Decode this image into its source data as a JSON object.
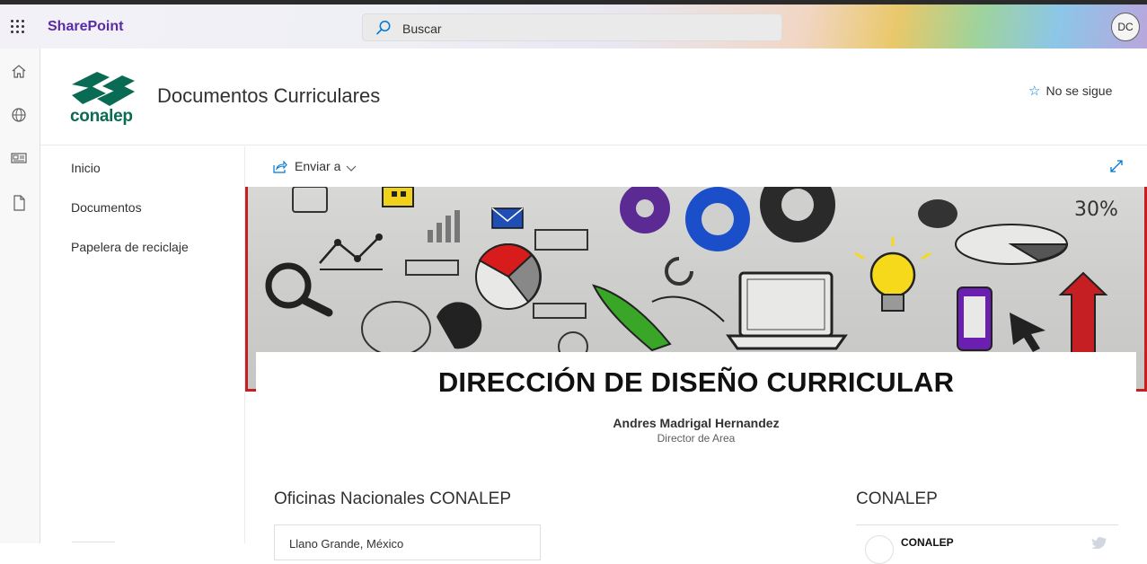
{
  "suite": {
    "brand": "SharePoint",
    "search_placeholder": "Buscar",
    "avatar_initials": "DC"
  },
  "rail": {
    "icons": [
      "home-icon",
      "globe-icon",
      "news-icon",
      "document-icon"
    ]
  },
  "site": {
    "logo_text": "conalep",
    "title": "Documentos Curriculares",
    "follow_label": "No se sigue"
  },
  "nav": {
    "items": [
      {
        "label": "Inicio"
      },
      {
        "label": "Documentos"
      },
      {
        "label": "Papelera de reciclaje"
      }
    ]
  },
  "commandbar": {
    "send_label": "Enviar a"
  },
  "hero": {
    "title": "DIRECCIÓN DE DISEÑO CURRICULAR",
    "person_name": "Andres Madrigal Hernandez",
    "person_role": "Director de Area"
  },
  "sections": {
    "left_title": "Oficinas Nacionales CONALEP",
    "left_location": "Llano Grande, México",
    "right_title": "CONALEP",
    "twitter_name": "CONALEP"
  },
  "colors": {
    "brand_purple": "#5b2ba6",
    "accent_blue": "#0078d4",
    "hero_border_red": "#c51f24",
    "conalep_green": "#0a6b55"
  }
}
